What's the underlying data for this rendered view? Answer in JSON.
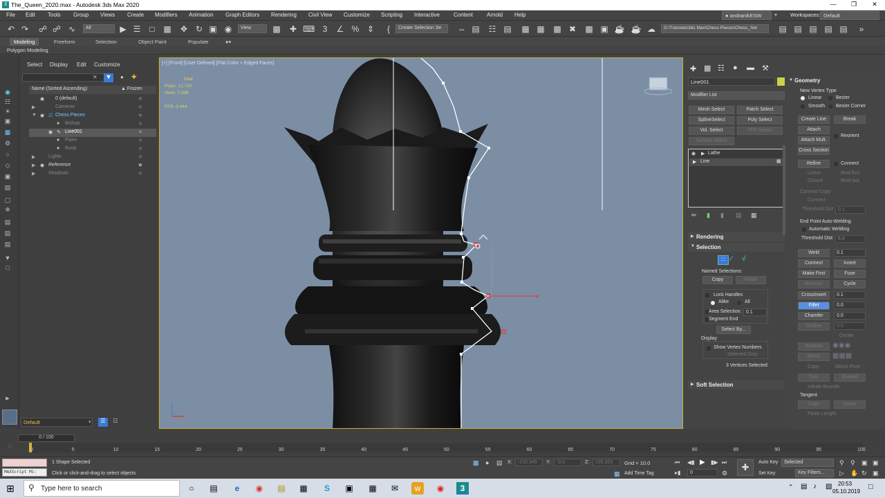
{
  "window": {
    "title": "The_Queen_2020.max - Autodesk 3ds Max 2020"
  },
  "menu": {
    "items": [
      "File",
      "Edit",
      "Tools",
      "Group",
      "Views",
      "Create",
      "Modifiers",
      "Animation",
      "Graph Editors",
      "Rendering",
      "Civil View",
      "Customize",
      "Scripting",
      "Interactive",
      "Content",
      "Arnold",
      "Help"
    ],
    "user": "andranikESW",
    "workspaces_label": "Workspaces:",
    "workspace": "Default"
  },
  "toolbar": {
    "filter": "All",
    "view": "View",
    "create_selection_set": "Create Selection Se",
    "project_path": "G:\\Tutorials\\3ds Max\\Chess Pieces\\Chess_Set"
  },
  "ribbon": {
    "tabs": [
      "Modeling",
      "Freeform",
      "Selection",
      "Object Paint",
      "Populate"
    ],
    "subtitle": "Polygon Modeling"
  },
  "scene_explorer": {
    "menu": [
      "Select",
      "Display",
      "Edit",
      "Customize"
    ],
    "col_name": "Name (Sorted Ascending)",
    "col_frozen": "▲ Frozen",
    "rows": [
      {
        "label": "0 (default)",
        "style": "normal"
      },
      {
        "label": "Cameras",
        "style": "dim"
      },
      {
        "label": "Chess Pieces",
        "style": "highlight"
      },
      {
        "label": "Bishop",
        "style": "dim"
      },
      {
        "label": "Line001",
        "style": "selected"
      },
      {
        "label": "Pawn",
        "style": "dim"
      },
      {
        "label": "Rook",
        "style": "dim"
      },
      {
        "label": "Lights",
        "style": "dim"
      },
      {
        "label": "Reference",
        "style": "italic"
      },
      {
        "label": "Shadows",
        "style": "dim"
      }
    ],
    "layer": "Default"
  },
  "viewport": {
    "label": "[+] [Front] [User Defined] [Flat Color + Edged Faces]",
    "stats": {
      "total": "Total",
      "polys_label": "Polys:",
      "polys": "12,720",
      "verts_label": "Verts:",
      "verts": "7,396",
      "fps_label": "FPS:",
      "fps": "0.444"
    }
  },
  "command_panel": {
    "object_name": "Line001",
    "modifier_list": "Modifier List",
    "buttons": [
      "Mesh Select",
      "Patch Select",
      "SplineSelect",
      "Poly Select",
      "Vol. Select",
      "FFD Select",
      "Surface Select"
    ],
    "stack": [
      "Lathe",
      "Line"
    ],
    "rollouts": {
      "rendering": "Rendering",
      "selection": "Selection",
      "soft_selection": "Soft Selection"
    },
    "named_selections": "Named Selections:",
    "copy": "Copy",
    "paste": "Paste",
    "lock_handles": "Lock Handles",
    "alike": "Alike",
    "all": "All",
    "area_selection": "Area Selection:",
    "area_value": "0.1",
    "segment_end": "Segment End",
    "select_by": "Select By...",
    "display": "Display",
    "show_vertex_numbers": "Show Vertex Numbers",
    "selected_only": "Selected Only",
    "vertices_selected": "3 Vertices Selected"
  },
  "geometry": {
    "title": "Geometry",
    "new_vertex_type": "New Vertex Type",
    "linear": "Linear",
    "bezier": "Bezier",
    "smooth": "Smooth",
    "bezier_corner": "Bezier Corner",
    "create_line": "Create Line",
    "break": "Break",
    "attach": "Attach",
    "reorient": "Reorient",
    "attach_mult": "Attach Mult.",
    "cross_section": "Cross Section",
    "refine": "Refine",
    "connect": "Connect",
    "refine_linear": "Linear",
    "bind_first": "Bind first",
    "closed": "Closed",
    "bind_last": "Bind last",
    "connect_copy": "Connect Copy",
    "connect2": "Connect",
    "threshold_dist": "Threshold Dist",
    "threshold_value": "0.1",
    "end_point_auto_welding": "End Point Auto-Welding",
    "automatic_welding": "Automatic Welding",
    "threshold_dist2": "Threshold Dist",
    "threshold_value2": "6.0",
    "weld": "Weld",
    "weld_value": "0.1",
    "connect3": "Connect",
    "insert": "Insert",
    "make_first": "Make First",
    "fuse": "Fuse",
    "reverse": "Reverse",
    "cycle": "Cycle",
    "cross_insert": "CrossInsert",
    "cross_insert_value": "0.1",
    "fillet": "Fillet",
    "fillet_value": "0.0",
    "chamfer": "Chamfer",
    "chamfer_value": "0.0",
    "outline": "Outline",
    "outline_value": "0.0",
    "center": "Center",
    "boolean": "Boolean",
    "mirror": "Mirror",
    "copy": "Copy",
    "about_pivot": "About Pivot",
    "trim": "Trim",
    "extend": "Extend",
    "infinite_bounds": "Infinite Bounds",
    "tangent": "Tangent",
    "tangent_copy": "Copy",
    "tangent_paste": "Paste",
    "paste_length": "Paste Length"
  },
  "timeline": {
    "frame": "0 / 100",
    "ticks": [
      "0",
      "5",
      "10",
      "15",
      "20",
      "25",
      "30",
      "35",
      "40",
      "45",
      "50",
      "55",
      "60",
      "65",
      "70",
      "75",
      "80",
      "85",
      "90",
      "95",
      "100"
    ]
  },
  "status": {
    "script_label": "MAXScript Mi:",
    "selected": "1 Shape Selected",
    "prompt": "Click or click-and-drag to select objects",
    "x_label": "X:",
    "x": "-210.349",
    "y_label": "Y:",
    "y": "-0.0",
    "z_label": "Z:",
    "z": "225.325",
    "grid": "Grid = 10.0",
    "add_time_tag": "Add Time Tag",
    "frame_field": "0",
    "auto_key": "Auto Key",
    "set_key": "Set Key",
    "key_mode": "Selected",
    "key_filters": "Key Filters..."
  },
  "taskbar": {
    "search": "Type here to search",
    "time": "20:53",
    "date": "05.10.2019"
  }
}
